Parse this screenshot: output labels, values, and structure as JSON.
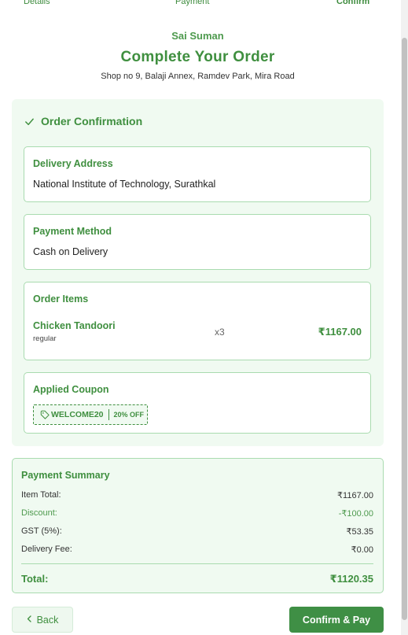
{
  "stepper": {
    "step1": "Details",
    "step2": "Payment",
    "step3": "Confirm"
  },
  "header": {
    "restaurant": "Sai Suman",
    "title": "Complete Your Order",
    "restaurant_address": "Shop no 9, Balaji Annex, Ramdev Park, Mira Road"
  },
  "confirmation": {
    "heading": "Order Confirmation",
    "delivery": {
      "title": "Delivery Address",
      "value": "National Institute of Technology, Surathkal"
    },
    "payment": {
      "title": "Payment Method",
      "value": "Cash on Delivery"
    },
    "items": {
      "title": "Order Items",
      "list": [
        {
          "name": "Chicken Tandoori",
          "variant": "regular",
          "qty": "x3",
          "price": "₹1167.00"
        }
      ]
    },
    "coupon": {
      "title": "Applied Coupon",
      "code": "WELCOME20",
      "discount": "20% OFF"
    }
  },
  "summary": {
    "title": "Payment Summary",
    "item_total_label": "Item Total:",
    "item_total": "₹1167.00",
    "discount_label": "Discount:",
    "discount": "-₹100.00",
    "gst_label": "GST (5%):",
    "gst": "₹53.35",
    "delivery_label": "Delivery Fee:",
    "delivery": "₹0.00",
    "total_label": "Total:",
    "total": "₹1120.35"
  },
  "actions": {
    "back": "Back",
    "confirm": "Confirm & Pay"
  },
  "colors": {
    "accent": "#3f8f3f",
    "panel": "#f0faf1",
    "border": "#a9dbaf",
    "button": "#3f8f45"
  }
}
